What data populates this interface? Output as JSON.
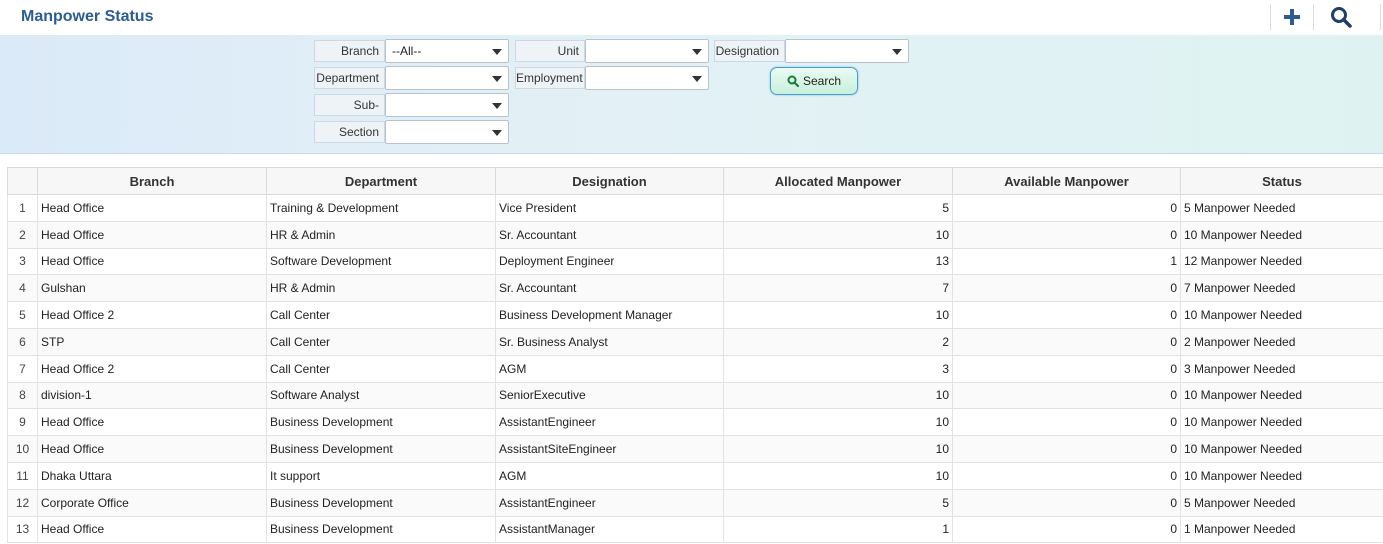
{
  "page": {
    "title": "Manpower Status"
  },
  "header_icons": {
    "add": "plus-icon",
    "search": "search-icon"
  },
  "filters": {
    "branch": {
      "label": "Branch",
      "value": "--All--"
    },
    "unit": {
      "label": "Unit",
      "value": ""
    },
    "designation": {
      "label": "Designation",
      "value": ""
    },
    "department": {
      "label": "Department",
      "value": ""
    },
    "employment": {
      "label": "Employment",
      "value": ""
    },
    "sub": {
      "label": "Sub-",
      "value": ""
    },
    "section": {
      "label": "Section",
      "value": ""
    },
    "search_label": "Search"
  },
  "table": {
    "columns": [
      "",
      "Branch",
      "Department",
      "Designation",
      "Allocated Manpower",
      "Available Manpower",
      "Status"
    ],
    "rows": [
      [
        "1",
        "Head Office",
        "Training & Development",
        "Vice President",
        "5",
        "0",
        "5 Manpower Needed"
      ],
      [
        "2",
        "Head Office",
        "HR &  Admin",
        "Sr. Accountant",
        "10",
        "0",
        "10 Manpower Needed"
      ],
      [
        "3",
        "Head Office",
        "Software Development",
        "Deployment Engineer",
        "13",
        "1",
        "12 Manpower Needed"
      ],
      [
        "4",
        "Gulshan",
        "HR &  Admin",
        "Sr. Accountant",
        "7",
        "0",
        "7 Manpower Needed"
      ],
      [
        "5",
        "Head Office 2",
        "Call Center",
        "Business Development Manager",
        "10",
        "0",
        "10 Manpower Needed"
      ],
      [
        "6",
        "STP",
        "Call Center",
        "Sr. Business Analyst",
        "2",
        "0",
        "2 Manpower Needed"
      ],
      [
        "7",
        "Head Office 2",
        "Call Center",
        "AGM",
        "3",
        "0",
        "3 Manpower Needed"
      ],
      [
        "8",
        "division-1",
        "Software Analyst",
        "SeniorExecutive",
        "10",
        "0",
        "10 Manpower Needed"
      ],
      [
        "9",
        "Head Office",
        "Business Development",
        "AssistantEngineer",
        "10",
        "0",
        "10 Manpower Needed"
      ],
      [
        "10",
        "Head Office",
        "Business Development",
        "AssistantSiteEngineer",
        "10",
        "0",
        "10 Manpower Needed"
      ],
      [
        "11",
        "Dhaka Uttara",
        "It support",
        "AGM",
        "10",
        "0",
        "10 Manpower Needed"
      ],
      [
        "12",
        "Corporate Office",
        "Business Development",
        "AssistantEngineer",
        "5",
        "0",
        "5 Manpower Needed"
      ],
      [
        "13",
        "Head Office",
        "Business Development",
        "AssistantManager",
        "1",
        "0",
        "1 Manpower Needed"
      ]
    ]
  }
}
